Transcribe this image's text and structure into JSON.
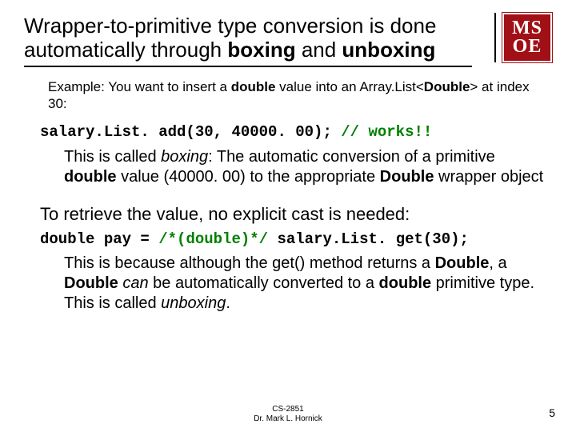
{
  "logo": {
    "line1": "MS",
    "line2": "OE"
  },
  "title": {
    "part1": "Wrapper-to-primitive type conversion is done automatically through ",
    "bold1": "boxing",
    "mid": " and ",
    "bold2": "unboxing"
  },
  "example_intro": {
    "t1": "Example: You want to insert a ",
    "b1": "double",
    "t2": " value into an Array.List<",
    "b2": "Double",
    "t3": "> at index 30:"
  },
  "code1": {
    "black": "salary.List. add(30, 40000. 00); ",
    "green": "// works!!"
  },
  "boxing_para": {
    "t1": "This is called ",
    "bi1": "boxing",
    "t2": ": The automatic conversion of a primitive ",
    "b1": "double",
    "t3": " value (40000. 00) to the appropriate ",
    "b2": "Double",
    "t4": " wrapper object"
  },
  "retrieve_line": "To retrieve the value, no explicit cast is needed:",
  "code2": {
    "black1": "double pay = ",
    "green": "/*(double)*/",
    "black2": " salary.List. get(30);"
  },
  "unboxing_para": {
    "t1": "This is because although the get() method returns a ",
    "b1": "Double",
    "t2": ", a ",
    "b2": "Double",
    "t3": " ",
    "i1": "can",
    "t4": " be automatically converted to a ",
    "b3": "double",
    "t5": " primitive type. This is called ",
    "i2": "unboxing",
    "t6": "."
  },
  "footer": {
    "course": "CS-2851",
    "author": "Dr. Mark L. Hornick"
  },
  "page_number": "5"
}
